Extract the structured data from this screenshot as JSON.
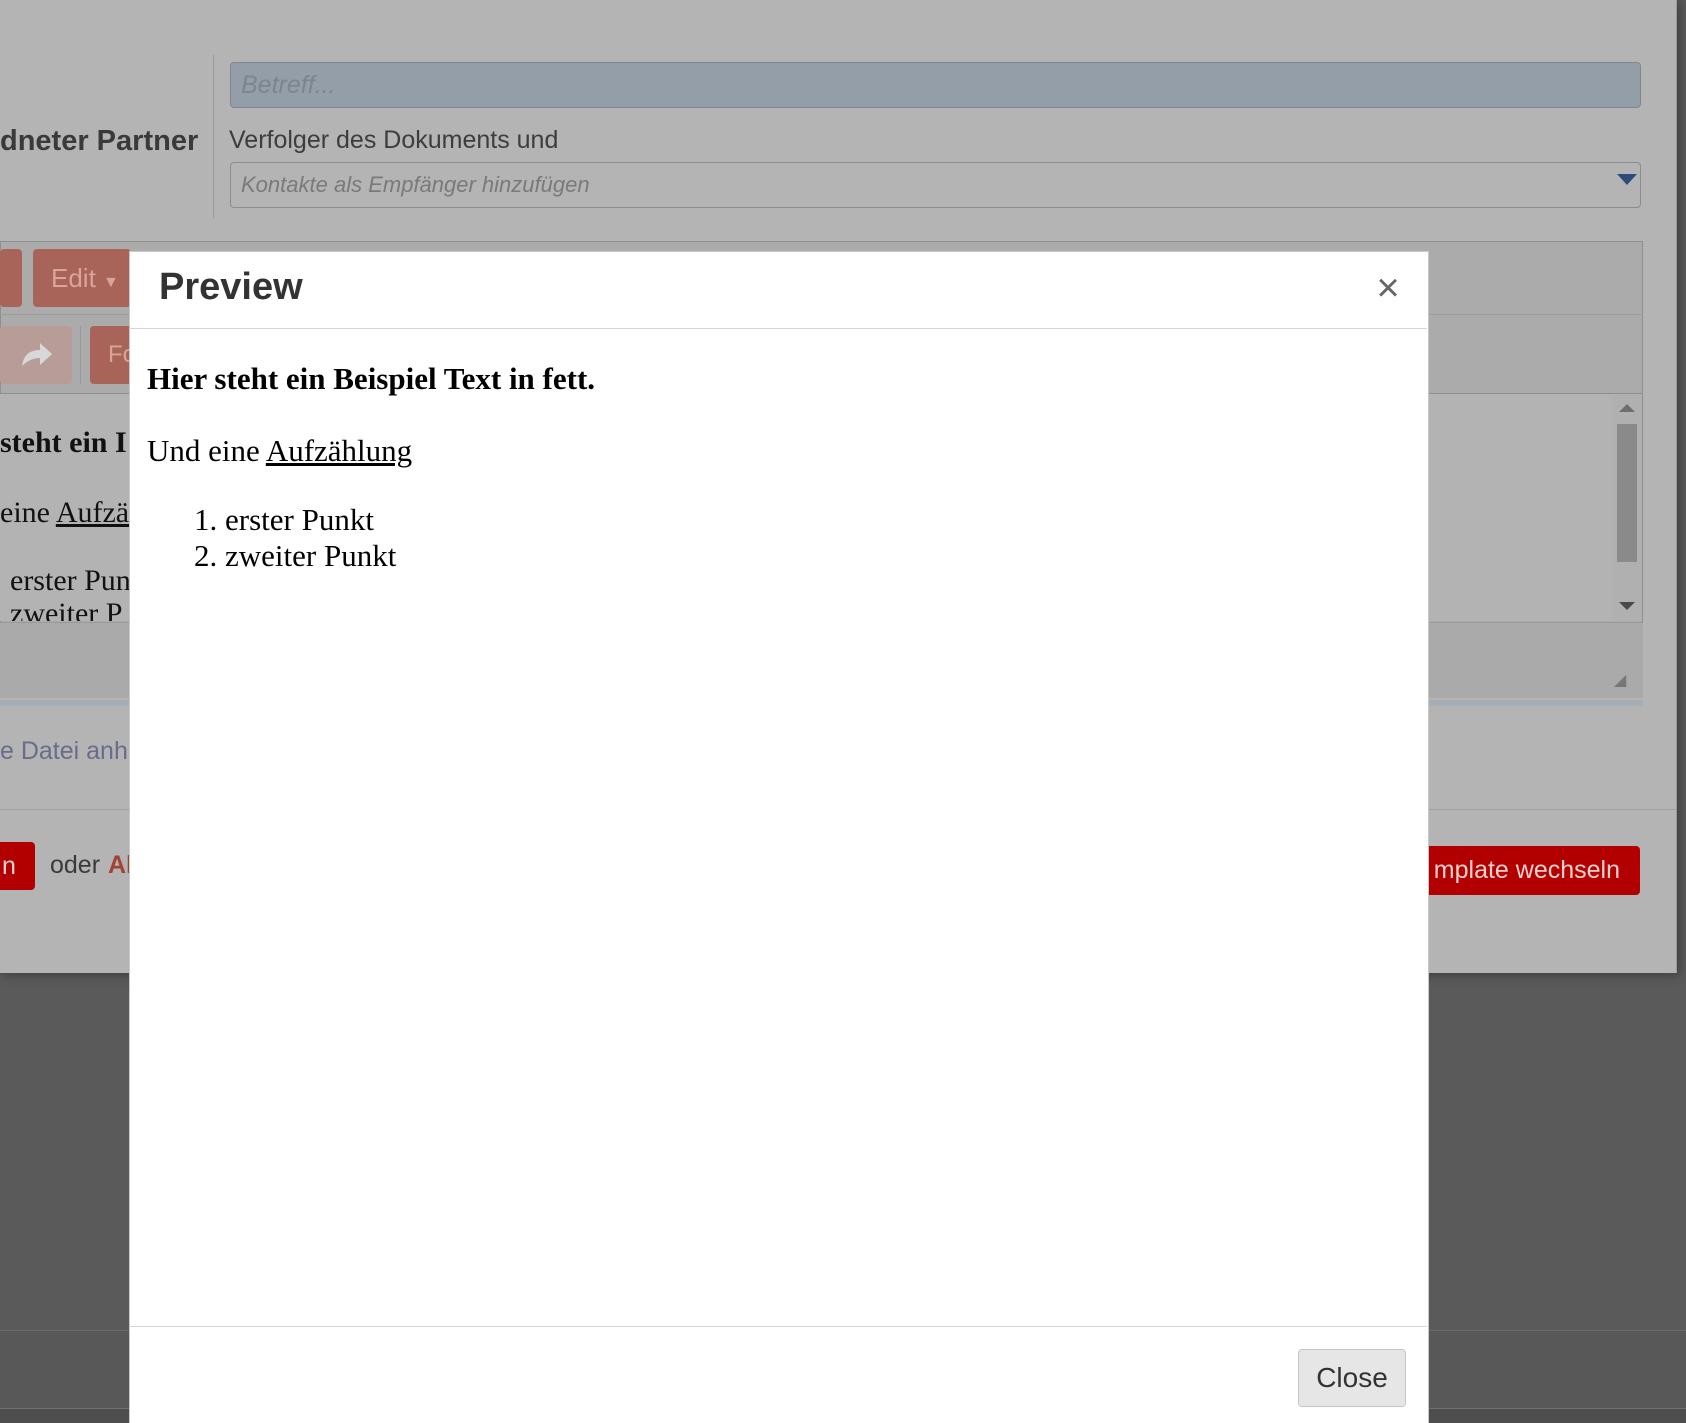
{
  "composer": {
    "partner_label": "dneter Partner",
    "subject_placeholder": "Betreff...",
    "followers_label": "Verfolger des Dokuments und",
    "recipients_placeholder": "Kontakte als Empfänger hinzufügen",
    "menu_edit_label": "Edit",
    "format_label": "Fo",
    "editor_line1": "steht ein I",
    "editor_line2_prefix": "eine ",
    "editor_line2_link": "Aufzä",
    "editor_line3": "erster Pun",
    "editor_line4": "zweiter P",
    "attach_label": "e Datei anh",
    "send_label": "n",
    "oder_label": "oder",
    "abort_label": "Al",
    "template_button_label": "mplate wechseln"
  },
  "preview": {
    "title": "Preview",
    "bold_line": "Hier steht ein Beispiel Text in fett.",
    "line2_prefix": "Und eine ",
    "line2_link": "Aufzählung",
    "list": [
      {
        "num": "1.",
        "text": "erster Punkt"
      },
      {
        "num": "2.",
        "text": "zweiter Punkt"
      }
    ],
    "close_label": "Close",
    "close_icon": "close-x-icon"
  },
  "colors": {
    "accent_red": "#b20000",
    "overlay": "#5a5a5a"
  }
}
